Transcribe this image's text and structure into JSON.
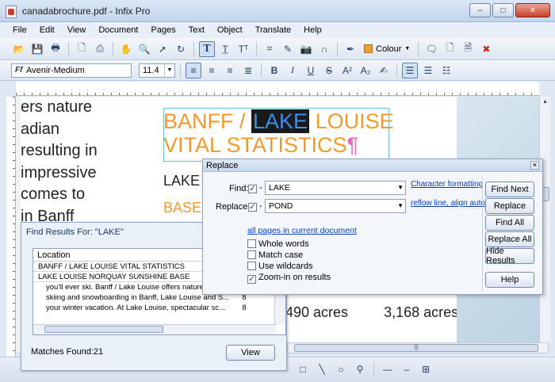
{
  "window": {
    "title": "canadabrochure.pdf - Infix Pro",
    "minimize": "–",
    "maximize": "□",
    "close": "✕"
  },
  "menu": [
    "File",
    "Edit",
    "View",
    "Document",
    "Pages",
    "Text",
    "Object",
    "Translate",
    "Help"
  ],
  "toolbar": {
    "colour_label": "Colour"
  },
  "format": {
    "font_name": "Avenir-Medium",
    "font_size": "11.4",
    "font_icon": "Ff"
  },
  "document": {
    "left_lines": [
      "ers nature",
      "adian",
      "resulting in",
      " impressive",
      " comes to",
      "    in Banff"
    ],
    "heading_line1_a": "BANFF / ",
    "heading_line1_hl": "LAKE",
    "heading_line1_b": " LOUISE",
    "heading_line2": "VITAL STATISTICS",
    "pilcrow": "¶",
    "lake_label": "LAKE",
    "base_label": "BASE",
    "acres_1": "490 acres",
    "acres_2": "3,168 acres"
  },
  "find_results": {
    "title": "Find Results For: \"LAKE\"",
    "column": "Location",
    "rows": [
      {
        "text": "BANFF / LAKE LOUISE VITAL STATISTICS",
        "count": "",
        "type": "header"
      },
      {
        "text": "LAKE LOUISE NORQUAY SUNSHINE BASE",
        "count": "",
        "type": "header"
      },
      {
        "text": "you'll ever ski. Banff / Lake Louise offers nature at its fi...",
        "count": "8",
        "type": "sub"
      },
      {
        "text": "skiing and snowboarding in Banff, Lake Louise and S...",
        "count": "8",
        "type": "sub"
      },
      {
        "text": "your winter vacation. At Lake Louise, spectacular sc...",
        "count": "8",
        "type": "sub"
      }
    ],
    "matches": "Matches Found:21",
    "view_button": "View"
  },
  "replace": {
    "title": "Replace",
    "find_label": "Find:",
    "find_value": "LAKE",
    "replace_label": "Replace:",
    "replace_value": "POND",
    "char_format_link": "Character formatting",
    "reflow_link": "reflow line, align auto",
    "scope_link": "all pages in current document",
    "dash": "-",
    "check_mark": "✓",
    "options": [
      {
        "label": "Whole words",
        "checked": false
      },
      {
        "label": "Match case",
        "checked": false
      },
      {
        "label": "Use wildcards",
        "checked": false
      },
      {
        "label": "Zoom-in on results",
        "checked": true
      }
    ],
    "buttons": [
      "Find Next",
      "Replace",
      "Find All",
      "Replace All",
      "Hide Results",
      "Help"
    ]
  }
}
